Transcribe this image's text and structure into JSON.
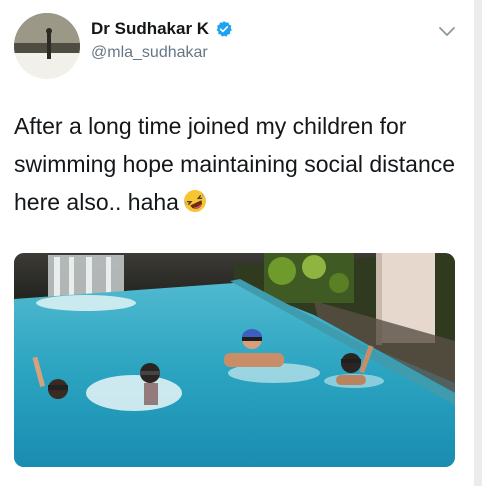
{
  "author": {
    "display_name": "Dr Sudhakar K",
    "handle": "@mla_sudhakar",
    "verified": true,
    "avatar_icon": "profile-avatar"
  },
  "tweet": {
    "text": "After a long time joined my children for swimming hope maintaining social distance here also.. haha",
    "emoji": "rolling-on-the-floor-laughing-emoji"
  },
  "media": {
    "type": "photo",
    "icon": "swimming-pool-photo"
  },
  "icons": {
    "verified": "verified-badge-icon",
    "menu": "chevron-down-icon"
  },
  "colors": {
    "name": "#14171a",
    "handle": "#657786",
    "verified_blue": "#1da1f2",
    "pool_water": "#2aa6c1"
  }
}
